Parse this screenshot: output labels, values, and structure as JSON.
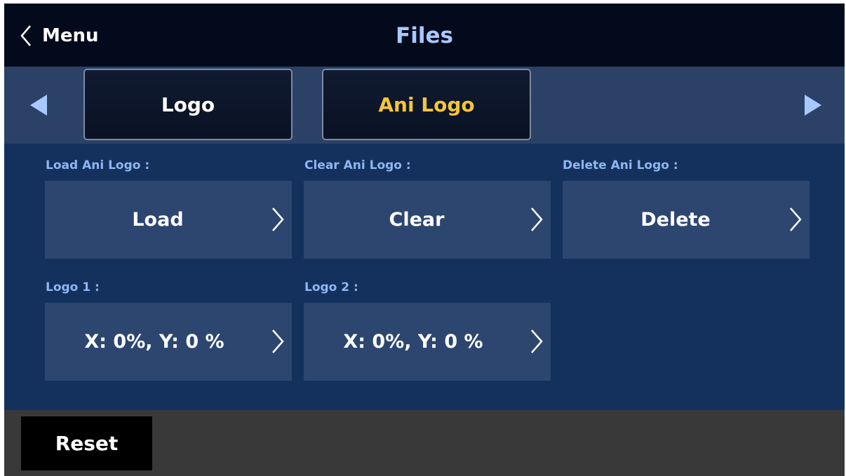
{
  "header": {
    "back_label": "Menu",
    "title": "Files"
  },
  "tabs": [
    {
      "label": "Logo",
      "active": false
    },
    {
      "label": "Ani Logo",
      "active": true
    }
  ],
  "settings": {
    "load": {
      "label": "Load Ani Logo :",
      "value": "Load"
    },
    "clear": {
      "label": "Clear Ani Logo :",
      "value": "Clear"
    },
    "delete": {
      "label": "Delete Ani Logo :",
      "value": "Delete"
    },
    "logo1": {
      "label": "Logo 1 :",
      "value": "X: 0%, Y: 0 %"
    },
    "logo2": {
      "label": "Logo 2 :",
      "value": "X: 0%, Y: 0 %"
    }
  },
  "footer": {
    "reset_label": "Reset"
  },
  "colors": {
    "header_bg": "#030a1c",
    "title": "#a9c8ff",
    "tabbar_bg": "#2b4166",
    "active_tab_text": "#f5c53a",
    "panel_bg": "#14315e",
    "card_bg": "#2c4670",
    "label_text": "#8fb6f2",
    "footer_bg": "#393939"
  },
  "icons": [
    "chevron-left-icon",
    "triangle-left-icon",
    "triangle-right-icon",
    "chevron-right-icon"
  ]
}
